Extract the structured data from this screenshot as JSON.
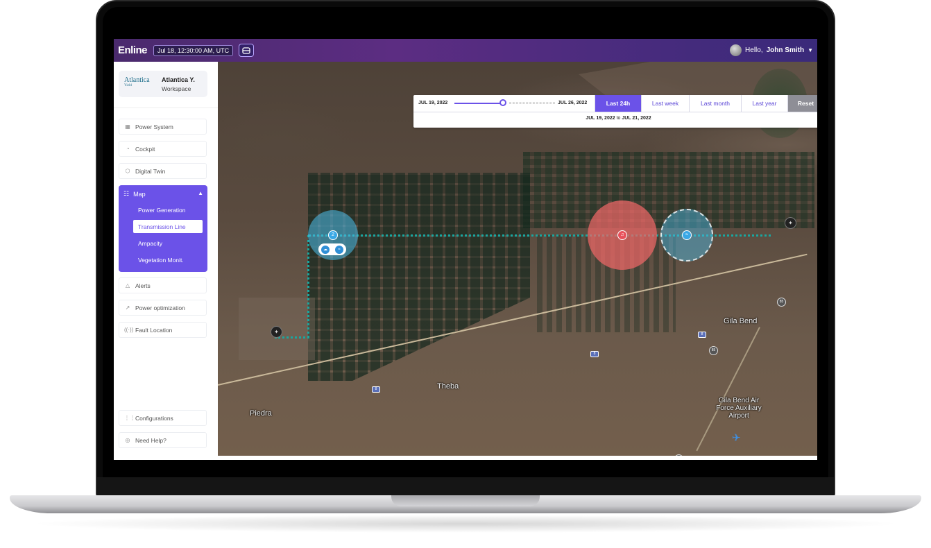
{
  "app": {
    "logo": "Enline",
    "datetime": "Jul 18, 12:30:00 AM, UTC"
  },
  "user": {
    "greeting": "Hello,",
    "name": "John Smith"
  },
  "workspace": {
    "logo_text": "Atlantica",
    "logo_sub": "Yield",
    "name": "Atlantica Y.",
    "sub": "Workspace"
  },
  "nav": {
    "power_system": "Power System",
    "cockpit": "Cockpit",
    "digital_twin": "Digital Twin",
    "map": "Map",
    "map_items": [
      "Power Generation",
      "Transmission Line",
      "Ampacity",
      "Vegetation Monit."
    ],
    "alerts": "Alerts",
    "power_optimization": "Power optimization",
    "fault_location": "Fault Location",
    "configurations": "Configurations",
    "need_help": "Need Help?"
  },
  "timebar": {
    "from": "JUL 19, 2022",
    "to": "JUL 26, 2022",
    "buttons": [
      "Last 24h",
      "Last week",
      "Last month",
      "Last year",
      "Reset"
    ],
    "active": "Last 24h",
    "range_from": "JUL 19, 2022",
    "range_sep": "to",
    "range_to": "JUL 21, 2022"
  },
  "map": {
    "places": [
      "Gila Bend",
      "Theba",
      "Piedra",
      "Gila Bend Air Force Auxiliary Airport"
    ],
    "cluster_count": "2",
    "route_shields": [
      "85",
      "85",
      "8",
      "8",
      "8",
      "85"
    ]
  },
  "colors": {
    "accent": "#6b52e8",
    "topbar": "#5c2d82",
    "line": "#1aa7a0",
    "alert": "#e8505b",
    "sensor": "#3aa8e6"
  }
}
